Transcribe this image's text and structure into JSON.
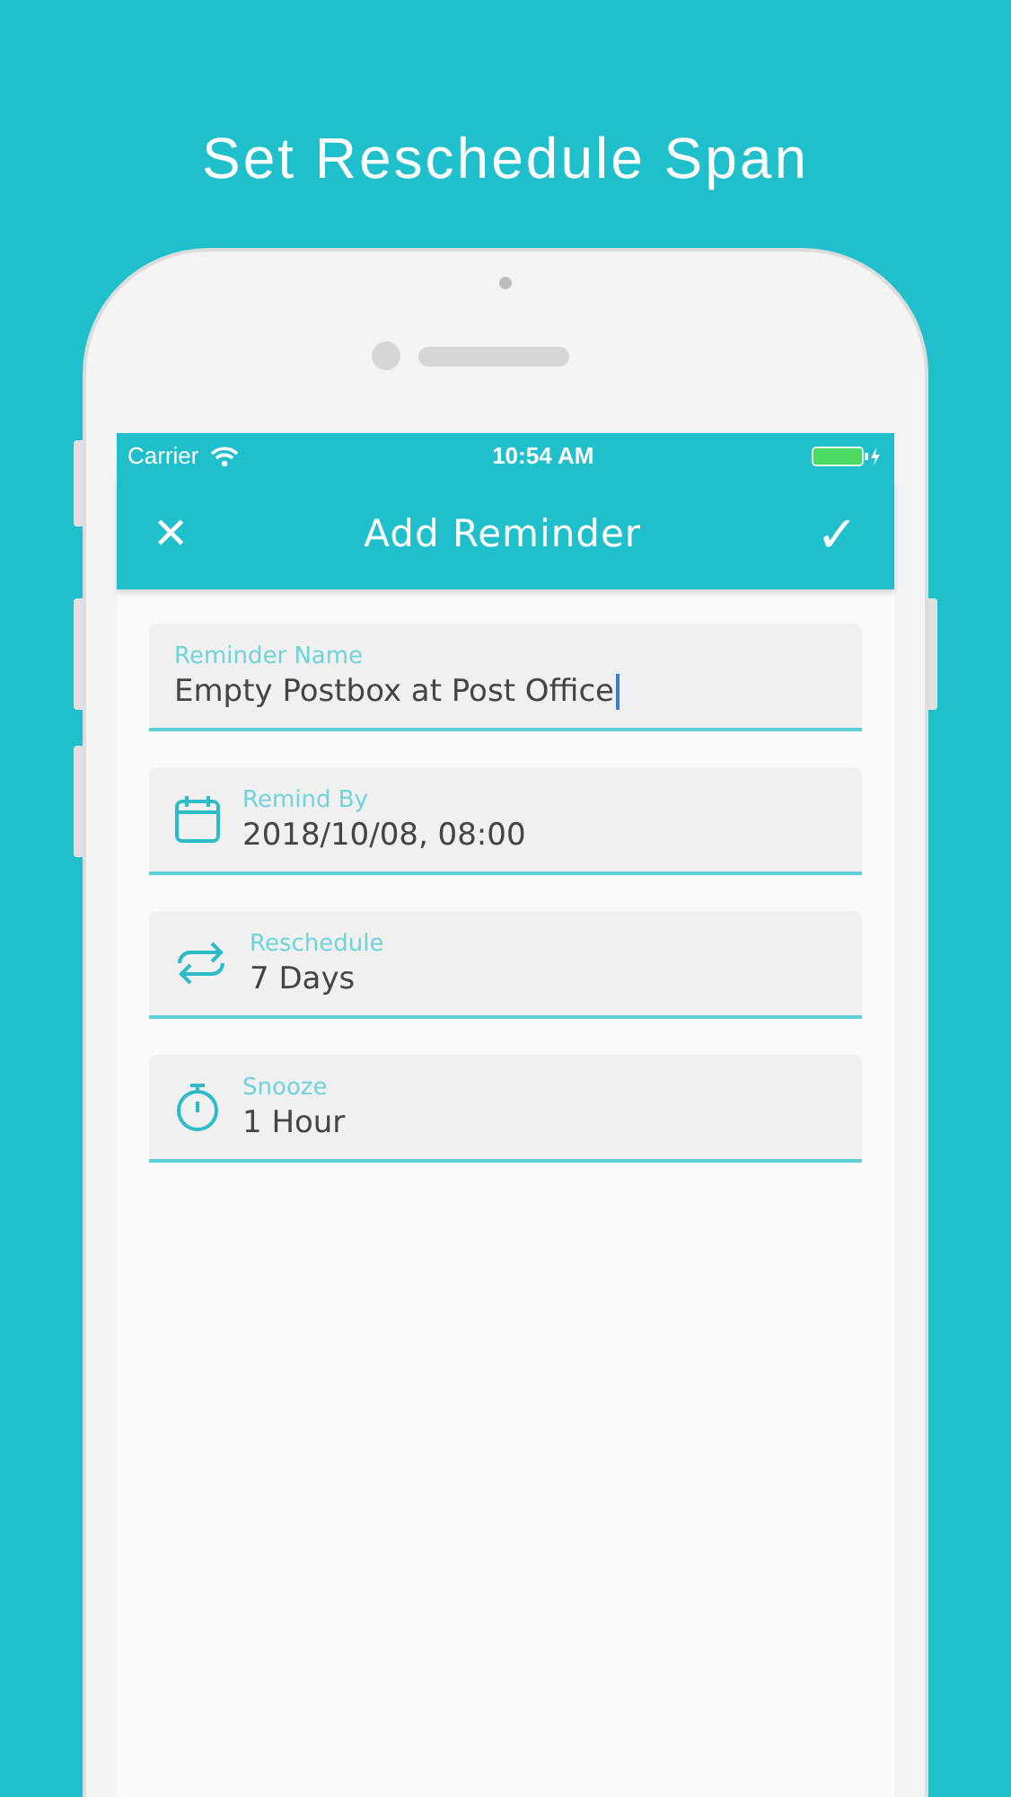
{
  "headline": "Set Reschedule Span",
  "status_bar": {
    "carrier": "Carrier",
    "time": "10:54 AM"
  },
  "nav": {
    "close": "✕",
    "title": "Add Reminder",
    "confirm": "✓"
  },
  "fields": [
    {
      "kind": "text",
      "label": "Reminder Name",
      "value": "Empty Postbox at Post Office",
      "focused": true
    },
    {
      "kind": "date",
      "label": "Remind By",
      "value": "2018/10/08, 08:00",
      "focused": false
    },
    {
      "kind": "repeat",
      "label": "Reschedule",
      "value": "7 Days",
      "focused": false
    },
    {
      "kind": "timer",
      "label": "Snooze",
      "value": "1 Hour",
      "focused": false
    }
  ]
}
